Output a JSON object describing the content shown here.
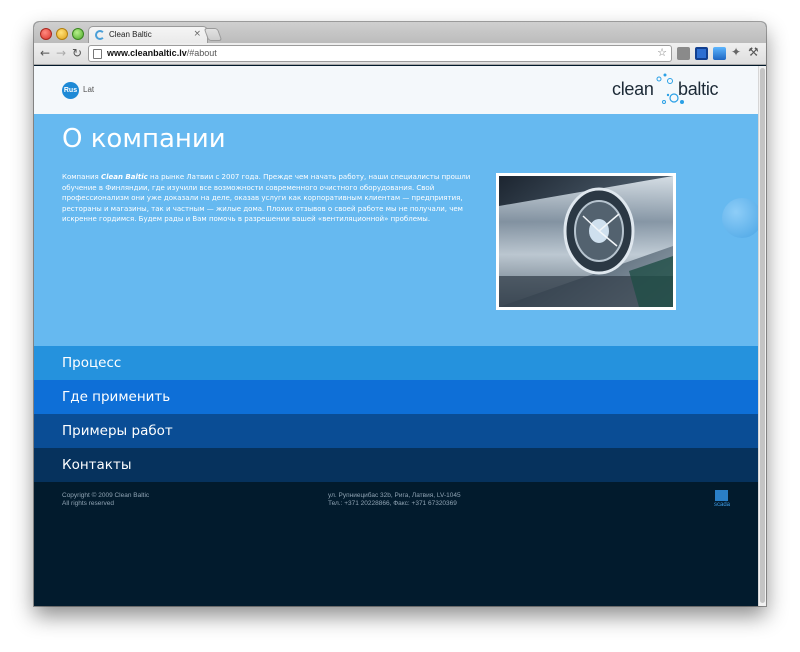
{
  "browser": {
    "tab_title": "Clean Baltic",
    "tab_close": "×",
    "url_host": "www.cleanbaltic.lv",
    "url_path": "/#about",
    "icons": [
      "back-icon",
      "forward-icon",
      "reload-icon",
      "star-icon"
    ]
  },
  "header": {
    "lang_active": "Rus",
    "lang_other": "Lat",
    "logo_left": "clean",
    "logo_right": "baltic",
    "brand_color": "#1e8ad6"
  },
  "about": {
    "title": "О компании",
    "text_prefix": "Компания ",
    "text_brand": "Clean Baltic",
    "text_body": " на рынке Латвии с 2007 года. Прежде чем начать работу, наши специалисты прошли обучение в Финляндии, где изучили все возможности современного очистного оборудования. Свой профессионализм они уже доказали на деле, оказав услуги как корпоративным клиентам — предприятия, рестораны и магазины, так и частным — жилые дома. Плохих отзывов о своей работе мы не получали, чем искренне гордимся. Будем рады и Вам помочь в разрешении вашей «вентиляционной» проблемы.",
    "bg_color": "#66b9f0"
  },
  "menu": {
    "items": [
      {
        "label": "Процесс"
      },
      {
        "label": "Где применить"
      },
      {
        "label": "Примеры работ"
      },
      {
        "label": "Контакты"
      }
    ]
  },
  "footer": {
    "copyright": "Copyright © 2009 Clean Baltic",
    "rights": "All rights reserved",
    "address": "ул. Рупниецибас 32b, Рига, Латвия, LV-1045",
    "phones": "Тел.: +371 20228866, Факс: +371 67320369",
    "scada": "scada"
  }
}
